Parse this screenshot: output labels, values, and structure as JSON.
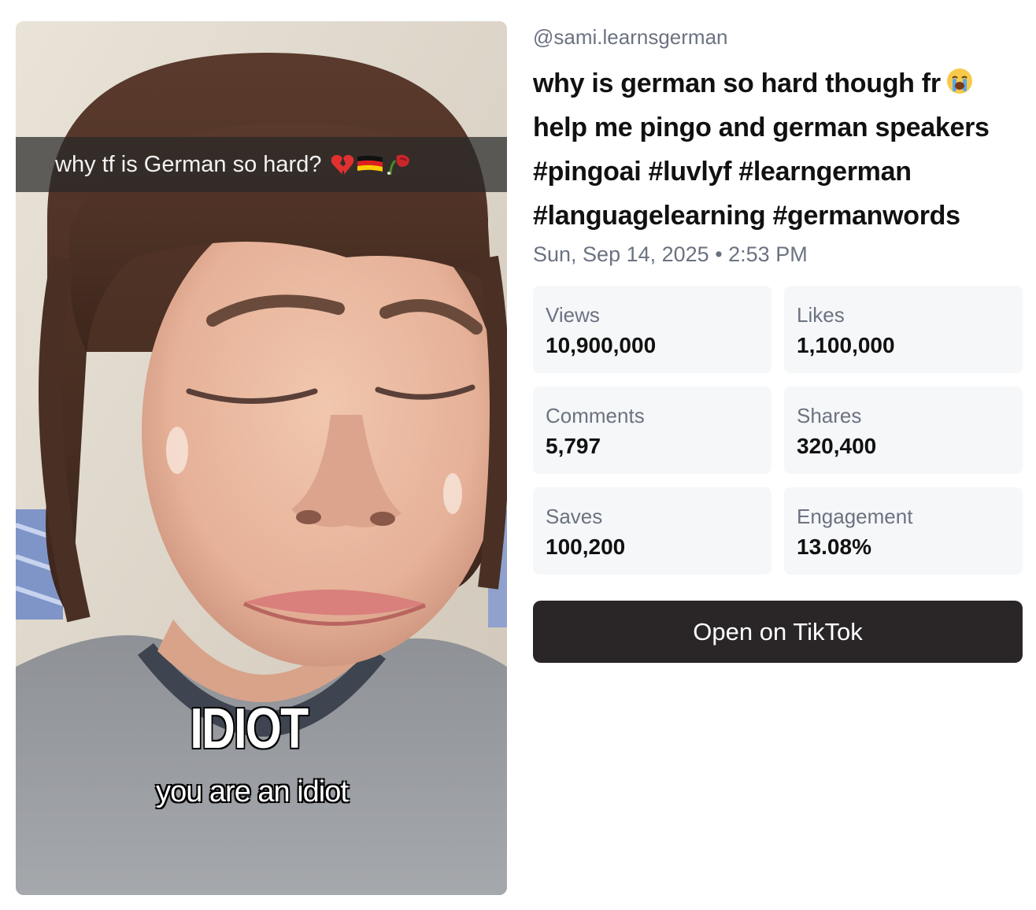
{
  "video": {
    "caption_bar_text": "why tf is German so hard?",
    "caption_emojis": [
      "broken-heart-icon",
      "german-flag-icon",
      "wilted-rose-icon"
    ],
    "overlay_big": "IDIOT",
    "overlay_sub": "you are an idiot"
  },
  "post": {
    "handle": "@sami.learnsgerman",
    "description_lines": [
      "why is german so hard though fr",
      "help me pingo and german speakers",
      "#pingoai #luvlyf #learngerman",
      "#languagelearning #germanwords"
    ],
    "description_emoji": "loudly-crying-face-icon",
    "date": "Sun, Sep 14, 2025 • 2:53 PM"
  },
  "stats": [
    {
      "label": "Views",
      "value": "10,900,000"
    },
    {
      "label": "Likes",
      "value": "1,100,000"
    },
    {
      "label": "Comments",
      "value": "5,797"
    },
    {
      "label": "Shares",
      "value": "320,400"
    },
    {
      "label": "Saves",
      "value": "100,200"
    },
    {
      "label": "Engagement",
      "value": "13.08%"
    }
  ],
  "actions": {
    "open_label": "Open on TikTok"
  }
}
